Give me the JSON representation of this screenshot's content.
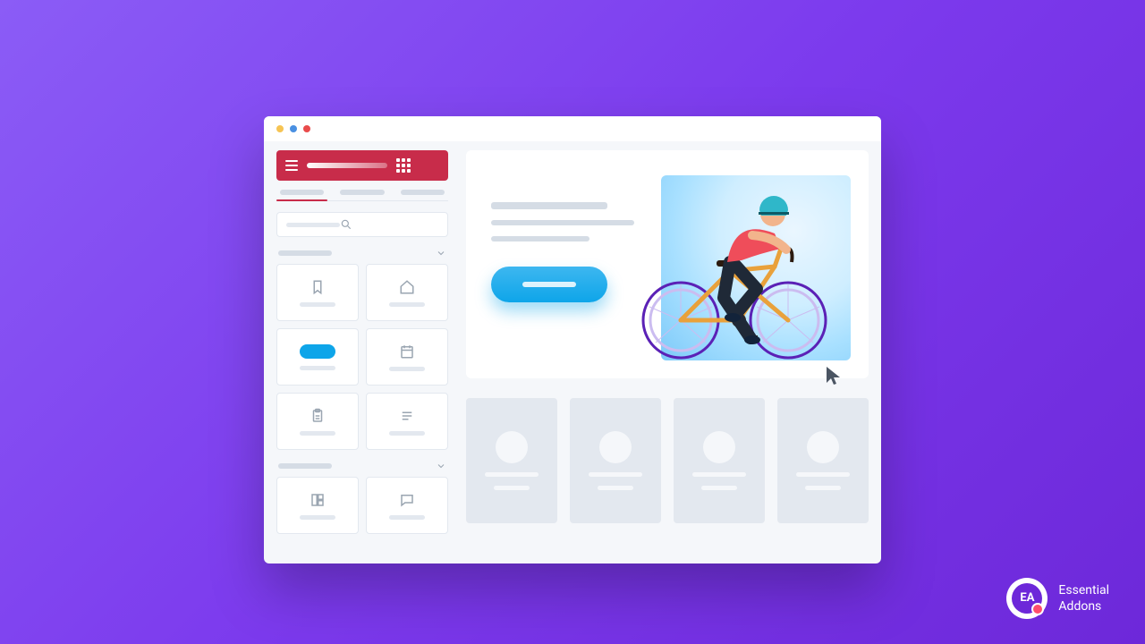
{
  "brand": {
    "line1": "Essential",
    "line2": "Addons",
    "badge_text": "EA"
  },
  "window": {
    "dots": [
      "yellow",
      "blue",
      "red"
    ]
  },
  "sidebar": {
    "topbar": {
      "hamburger_icon": "menu-icon",
      "apps_icon": "apps-grid-icon"
    },
    "tabs": [
      {
        "active": true
      },
      {
        "active": false
      },
      {
        "active": false
      }
    ],
    "search": {
      "placeholder": "",
      "icon": "search-icon"
    },
    "sections": [
      {
        "tiles": [
          {
            "icon": "bookmark-icon"
          },
          {
            "icon": "home-icon"
          }
        ]
      },
      {
        "tiles": [
          {
            "icon": "pill-active",
            "active": true
          },
          {
            "icon": "calendar-icon"
          }
        ]
      },
      {
        "tiles": [
          {
            "icon": "clipboard-icon"
          },
          {
            "icon": "text-lines-icon"
          }
        ]
      },
      {
        "tiles": [
          {
            "icon": "layout-icon"
          },
          {
            "icon": "chat-icon"
          }
        ]
      }
    ]
  },
  "hero": {
    "cta_label": "",
    "cursor_icon": "cursor-icon",
    "illustration": "cyclist-illustration"
  },
  "cards": [
    {},
    {},
    {},
    {}
  ]
}
